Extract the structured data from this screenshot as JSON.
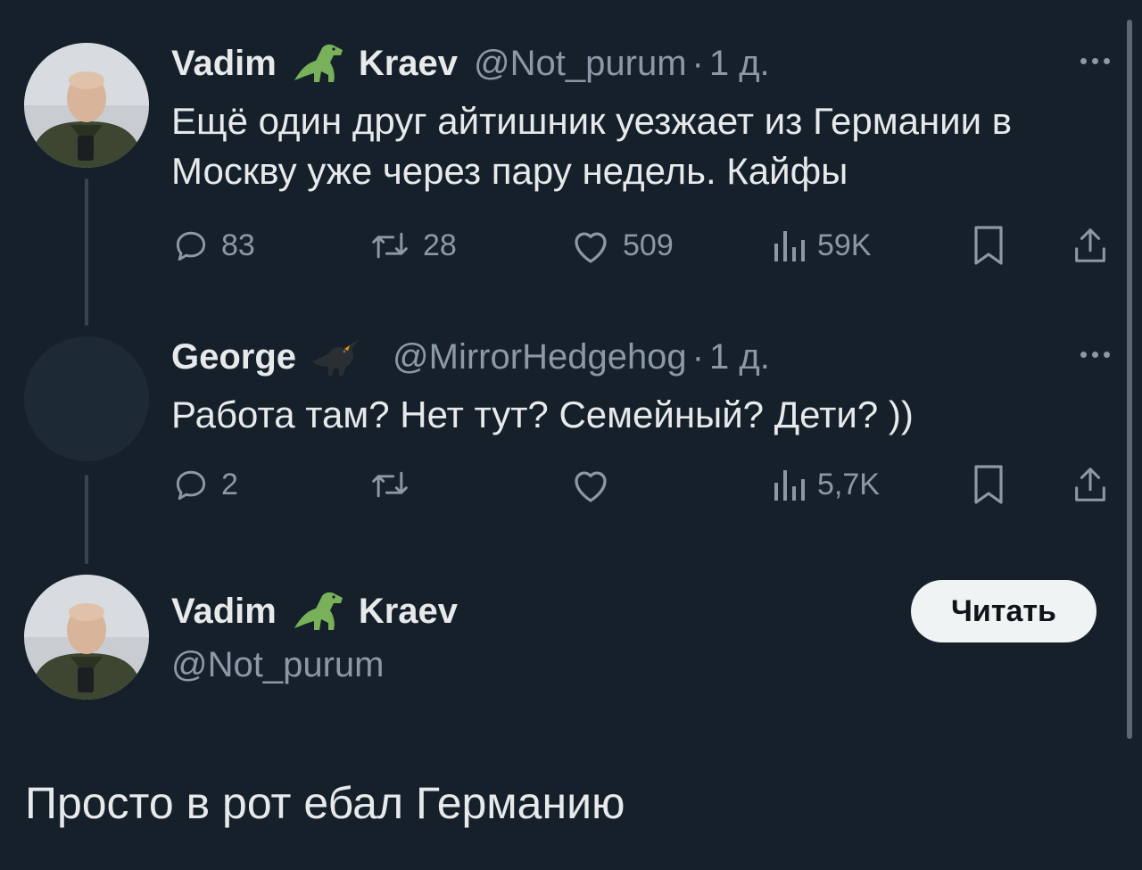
{
  "tweet1": {
    "first_name": "Vadim",
    "emoji": "t-rex-emoji",
    "last_name": "Kraev",
    "handle": "@Not_purum",
    "separator": "·",
    "time": "1 д.",
    "text": "Ещё один друг айтишник уезжает из Германии в Москву уже через пару недель. Кайфы",
    "replies": "83",
    "retweets": "28",
    "likes": "509",
    "views": "59K"
  },
  "tweet2": {
    "name": "George",
    "emoji": "blackbird-emoji",
    "handle": "@MirrorHedgehog",
    "separator": "·",
    "time": "1 д.",
    "text": "Работа там? Нет тут? Семейный? Дети? ))",
    "replies": "2",
    "retweets": "",
    "likes": "",
    "views": "5,7K"
  },
  "main_tweet": {
    "first_name": "Vadim",
    "emoji": "t-rex-emoji",
    "last_name": "Kraev",
    "handle": "@Not_purum",
    "follow_label": "Читать",
    "text": "Просто в рот ебал Германию"
  },
  "colors": {
    "background": "#15202b",
    "text": "#e7e9ea",
    "secondary": "#8b98a5",
    "thread_line": "#38444d",
    "button_bg": "#eff3f4"
  },
  "icons": [
    "reply-icon",
    "retweet-icon",
    "like-icon",
    "views-icon",
    "bookmark-icon",
    "share-icon",
    "more-icon"
  ]
}
